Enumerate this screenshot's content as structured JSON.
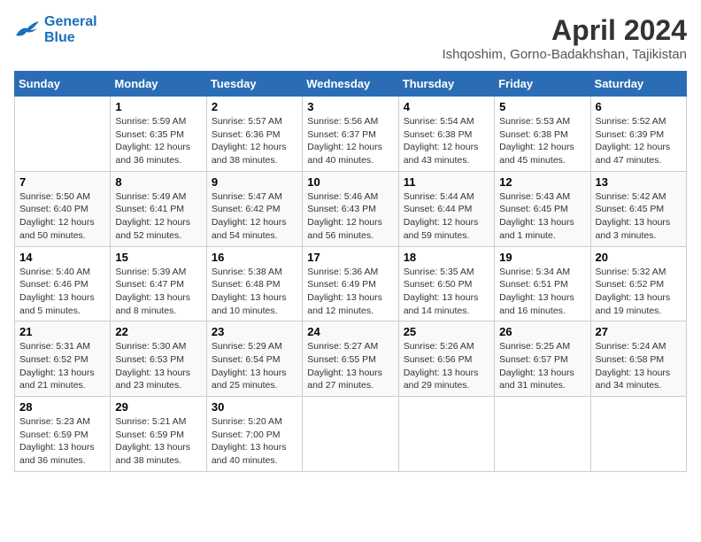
{
  "logo": {
    "line1": "General",
    "line2": "Blue"
  },
  "title": "April 2024",
  "subtitle": "Ishqoshim, Gorno-Badakhshan, Tajikistan",
  "weekdays": [
    "Sunday",
    "Monday",
    "Tuesday",
    "Wednesday",
    "Thursday",
    "Friday",
    "Saturday"
  ],
  "weeks": [
    [
      {
        "day": "",
        "info": ""
      },
      {
        "day": "1",
        "info": "Sunrise: 5:59 AM\nSunset: 6:35 PM\nDaylight: 12 hours\nand 36 minutes."
      },
      {
        "day": "2",
        "info": "Sunrise: 5:57 AM\nSunset: 6:36 PM\nDaylight: 12 hours\nand 38 minutes."
      },
      {
        "day": "3",
        "info": "Sunrise: 5:56 AM\nSunset: 6:37 PM\nDaylight: 12 hours\nand 40 minutes."
      },
      {
        "day": "4",
        "info": "Sunrise: 5:54 AM\nSunset: 6:38 PM\nDaylight: 12 hours\nand 43 minutes."
      },
      {
        "day": "5",
        "info": "Sunrise: 5:53 AM\nSunset: 6:38 PM\nDaylight: 12 hours\nand 45 minutes."
      },
      {
        "day": "6",
        "info": "Sunrise: 5:52 AM\nSunset: 6:39 PM\nDaylight: 12 hours\nand 47 minutes."
      }
    ],
    [
      {
        "day": "7",
        "info": "Sunrise: 5:50 AM\nSunset: 6:40 PM\nDaylight: 12 hours\nand 50 minutes."
      },
      {
        "day": "8",
        "info": "Sunrise: 5:49 AM\nSunset: 6:41 PM\nDaylight: 12 hours\nand 52 minutes."
      },
      {
        "day": "9",
        "info": "Sunrise: 5:47 AM\nSunset: 6:42 PM\nDaylight: 12 hours\nand 54 minutes."
      },
      {
        "day": "10",
        "info": "Sunrise: 5:46 AM\nSunset: 6:43 PM\nDaylight: 12 hours\nand 56 minutes."
      },
      {
        "day": "11",
        "info": "Sunrise: 5:44 AM\nSunset: 6:44 PM\nDaylight: 12 hours\nand 59 minutes."
      },
      {
        "day": "12",
        "info": "Sunrise: 5:43 AM\nSunset: 6:45 PM\nDaylight: 13 hours\nand 1 minute."
      },
      {
        "day": "13",
        "info": "Sunrise: 5:42 AM\nSunset: 6:45 PM\nDaylight: 13 hours\nand 3 minutes."
      }
    ],
    [
      {
        "day": "14",
        "info": "Sunrise: 5:40 AM\nSunset: 6:46 PM\nDaylight: 13 hours\nand 5 minutes."
      },
      {
        "day": "15",
        "info": "Sunrise: 5:39 AM\nSunset: 6:47 PM\nDaylight: 13 hours\nand 8 minutes."
      },
      {
        "day": "16",
        "info": "Sunrise: 5:38 AM\nSunset: 6:48 PM\nDaylight: 13 hours\nand 10 minutes."
      },
      {
        "day": "17",
        "info": "Sunrise: 5:36 AM\nSunset: 6:49 PM\nDaylight: 13 hours\nand 12 minutes."
      },
      {
        "day": "18",
        "info": "Sunrise: 5:35 AM\nSunset: 6:50 PM\nDaylight: 13 hours\nand 14 minutes."
      },
      {
        "day": "19",
        "info": "Sunrise: 5:34 AM\nSunset: 6:51 PM\nDaylight: 13 hours\nand 16 minutes."
      },
      {
        "day": "20",
        "info": "Sunrise: 5:32 AM\nSunset: 6:52 PM\nDaylight: 13 hours\nand 19 minutes."
      }
    ],
    [
      {
        "day": "21",
        "info": "Sunrise: 5:31 AM\nSunset: 6:52 PM\nDaylight: 13 hours\nand 21 minutes."
      },
      {
        "day": "22",
        "info": "Sunrise: 5:30 AM\nSunset: 6:53 PM\nDaylight: 13 hours\nand 23 minutes."
      },
      {
        "day": "23",
        "info": "Sunrise: 5:29 AM\nSunset: 6:54 PM\nDaylight: 13 hours\nand 25 minutes."
      },
      {
        "day": "24",
        "info": "Sunrise: 5:27 AM\nSunset: 6:55 PM\nDaylight: 13 hours\nand 27 minutes."
      },
      {
        "day": "25",
        "info": "Sunrise: 5:26 AM\nSunset: 6:56 PM\nDaylight: 13 hours\nand 29 minutes."
      },
      {
        "day": "26",
        "info": "Sunrise: 5:25 AM\nSunset: 6:57 PM\nDaylight: 13 hours\nand 31 minutes."
      },
      {
        "day": "27",
        "info": "Sunrise: 5:24 AM\nSunset: 6:58 PM\nDaylight: 13 hours\nand 34 minutes."
      }
    ],
    [
      {
        "day": "28",
        "info": "Sunrise: 5:23 AM\nSunset: 6:59 PM\nDaylight: 13 hours\nand 36 minutes."
      },
      {
        "day": "29",
        "info": "Sunrise: 5:21 AM\nSunset: 6:59 PM\nDaylight: 13 hours\nand 38 minutes."
      },
      {
        "day": "30",
        "info": "Sunrise: 5:20 AM\nSunset: 7:00 PM\nDaylight: 13 hours\nand 40 minutes."
      },
      {
        "day": "",
        "info": ""
      },
      {
        "day": "",
        "info": ""
      },
      {
        "day": "",
        "info": ""
      },
      {
        "day": "",
        "info": ""
      }
    ]
  ]
}
